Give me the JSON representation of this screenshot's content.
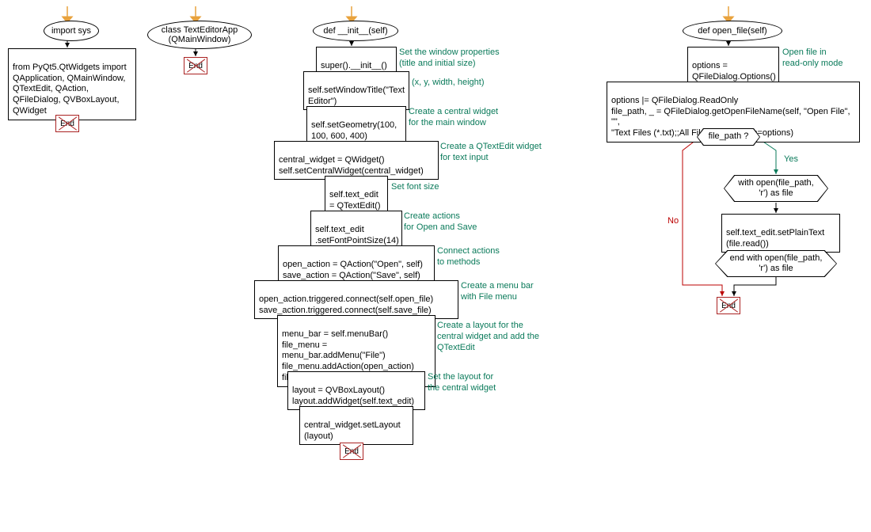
{
  "col1": {
    "start": "import sys",
    "box1": "from PyQt5.QtWidgets import\nQApplication, QMainWindow,\nQTextEdit, QAction,\nQFileDialog, QVBoxLayout,\nQWidget",
    "end": "End"
  },
  "col2": {
    "start": "class TextEditorApp\n(QMainWindow)",
    "end": "End"
  },
  "col3": {
    "start": "def __init__(self)",
    "b1": "super().__init__()",
    "c1": "Set the window properties\n(title and initial size)",
    "b2": "self.setWindowTitle(\"Text\nEditor\")",
    "c2": "(x, y, width, height)",
    "b3": "self.setGeometry(100,\n100, 600, 400)",
    "c3": "Create a central widget\nfor the main window",
    "b4": "central_widget = QWidget()\nself.setCentralWidget(central_widget)",
    "c4": "Create a QTextEdit widget\nfor text input",
    "b5": "self.text_edit\n= QTextEdit()",
    "c5": "Set font size",
    "b6": "self.text_edit\n.setFontPointSize(14)",
    "c6": "Create actions\nfor Open and Save",
    "b7": "open_action = QAction(\"Open\", self)\nsave_action = QAction(\"Save\", self)",
    "c7": "Connect actions\nto methods",
    "b8": "open_action.triggered.connect(self.open_file)\nsave_action.triggered.connect(self.save_file)",
    "c8": "Create a menu bar\nwith File menu",
    "b9": "menu_bar = self.menuBar()\nfile_menu = menu_bar.addMenu(\"File\")\nfile_menu.addAction(open_action)\nfile_menu.addAction(save_action)",
    "c9": "Create a layout for the\ncentral widget and add the\nQTextEdit",
    "b10": "layout = QVBoxLayout()\nlayout.addWidget(self.text_edit)",
    "c10": "Set the layout for\nthe central widget",
    "b11": "central_widget.setLayout\n(layout)",
    "end": "End"
  },
  "col4": {
    "start": "def open_file(self)",
    "b1": "options =\nQFileDialog.Options()",
    "c1": "Open file in\nread-only mode",
    "b2": "options |= QFileDialog.ReadOnly\nfile_path, _ = QFileDialog.getOpenFileName(self, \"Open File\", \"\",\n\"Text Files (*.txt);;All Files (*)\", options=options)",
    "cond": "file_path ?",
    "yes": "Yes",
    "no": "No",
    "b3": "with open(file_path,\n'r') as file",
    "b4": "self.text_edit.setPlainText\n(file.read())",
    "b5": "end with open(file_path,\n'r') as file",
    "end": "End"
  }
}
